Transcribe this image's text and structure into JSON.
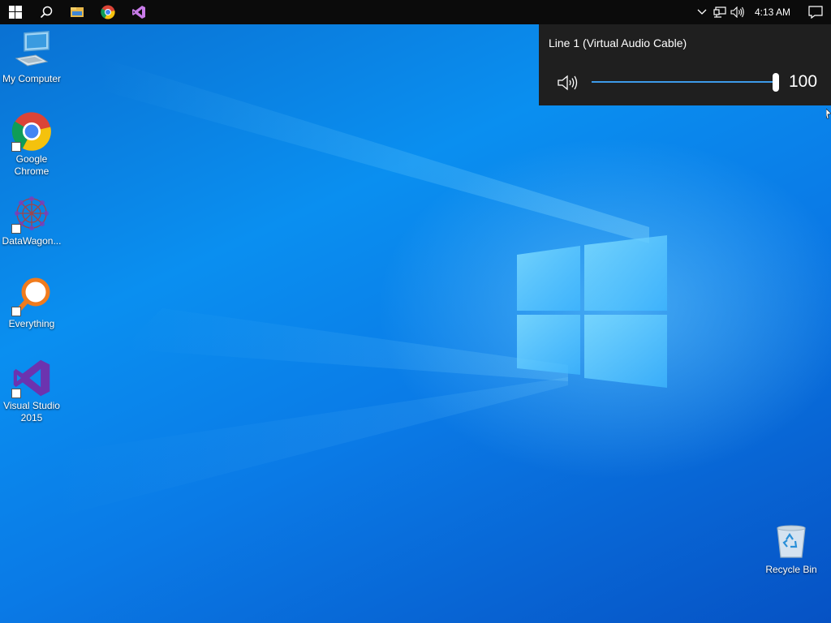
{
  "taskbar": {
    "start_icon": "windows-start-icon",
    "search_icon": "search-icon",
    "pinned": [
      {
        "name": "file-explorer-icon"
      },
      {
        "name": "chrome-icon"
      },
      {
        "name": "visual-studio-icon"
      }
    ],
    "tray": {
      "chevron": "chevron-up-icon",
      "network": "network-icon",
      "volume": "speaker-icon",
      "clock": "4:13 AM",
      "notifications": "action-center-icon"
    }
  },
  "volume_flyout": {
    "device_name": "Line 1 (Virtual Audio Cable)",
    "value": "100",
    "level_percent": 100,
    "accent": "#3d9be9"
  },
  "desktop_icons": [
    {
      "label": "My Computer",
      "icon": "computer-icon"
    },
    {
      "label": "Google Chrome",
      "icon": "chrome-icon"
    },
    {
      "label": "DataWagon...",
      "icon": "datawagon-icon"
    },
    {
      "label": "Everything",
      "icon": "everything-search-icon"
    },
    {
      "label": "Visual Studio 2015",
      "icon": "visual-studio-icon"
    },
    {
      "label": "Recycle Bin",
      "icon": "recycle-bin-icon"
    }
  ]
}
